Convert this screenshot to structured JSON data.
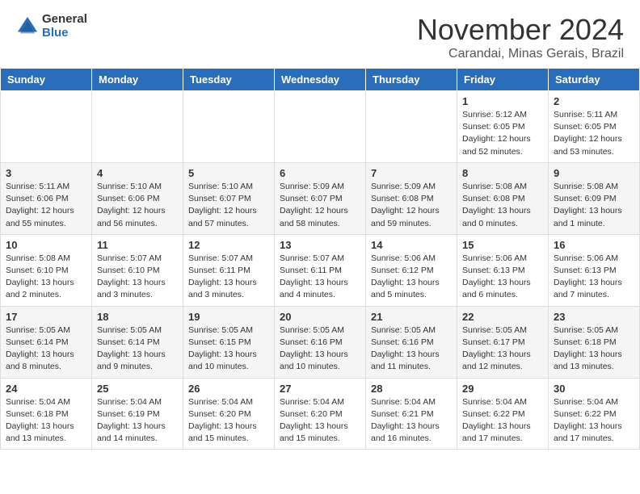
{
  "logo": {
    "general": "General",
    "blue": "Blue"
  },
  "title": "November 2024",
  "location": "Carandai, Minas Gerais, Brazil",
  "days_of_week": [
    "Sunday",
    "Monday",
    "Tuesday",
    "Wednesday",
    "Thursday",
    "Friday",
    "Saturday"
  ],
  "weeks": [
    [
      {
        "day": "",
        "info": ""
      },
      {
        "day": "",
        "info": ""
      },
      {
        "day": "",
        "info": ""
      },
      {
        "day": "",
        "info": ""
      },
      {
        "day": "",
        "info": ""
      },
      {
        "day": "1",
        "info": "Sunrise: 5:12 AM\nSunset: 6:05 PM\nDaylight: 12 hours\nand 52 minutes."
      },
      {
        "day": "2",
        "info": "Sunrise: 5:11 AM\nSunset: 6:05 PM\nDaylight: 12 hours\nand 53 minutes."
      }
    ],
    [
      {
        "day": "3",
        "info": "Sunrise: 5:11 AM\nSunset: 6:06 PM\nDaylight: 12 hours\nand 55 minutes."
      },
      {
        "day": "4",
        "info": "Sunrise: 5:10 AM\nSunset: 6:06 PM\nDaylight: 12 hours\nand 56 minutes."
      },
      {
        "day": "5",
        "info": "Sunrise: 5:10 AM\nSunset: 6:07 PM\nDaylight: 12 hours\nand 57 minutes."
      },
      {
        "day": "6",
        "info": "Sunrise: 5:09 AM\nSunset: 6:07 PM\nDaylight: 12 hours\nand 58 minutes."
      },
      {
        "day": "7",
        "info": "Sunrise: 5:09 AM\nSunset: 6:08 PM\nDaylight: 12 hours\nand 59 minutes."
      },
      {
        "day": "8",
        "info": "Sunrise: 5:08 AM\nSunset: 6:08 PM\nDaylight: 13 hours\nand 0 minutes."
      },
      {
        "day": "9",
        "info": "Sunrise: 5:08 AM\nSunset: 6:09 PM\nDaylight: 13 hours\nand 1 minute."
      }
    ],
    [
      {
        "day": "10",
        "info": "Sunrise: 5:08 AM\nSunset: 6:10 PM\nDaylight: 13 hours\nand 2 minutes."
      },
      {
        "day": "11",
        "info": "Sunrise: 5:07 AM\nSunset: 6:10 PM\nDaylight: 13 hours\nand 3 minutes."
      },
      {
        "day": "12",
        "info": "Sunrise: 5:07 AM\nSunset: 6:11 PM\nDaylight: 13 hours\nand 3 minutes."
      },
      {
        "day": "13",
        "info": "Sunrise: 5:07 AM\nSunset: 6:11 PM\nDaylight: 13 hours\nand 4 minutes."
      },
      {
        "day": "14",
        "info": "Sunrise: 5:06 AM\nSunset: 6:12 PM\nDaylight: 13 hours\nand 5 minutes."
      },
      {
        "day": "15",
        "info": "Sunrise: 5:06 AM\nSunset: 6:13 PM\nDaylight: 13 hours\nand 6 minutes."
      },
      {
        "day": "16",
        "info": "Sunrise: 5:06 AM\nSunset: 6:13 PM\nDaylight: 13 hours\nand 7 minutes."
      }
    ],
    [
      {
        "day": "17",
        "info": "Sunrise: 5:05 AM\nSunset: 6:14 PM\nDaylight: 13 hours\nand 8 minutes."
      },
      {
        "day": "18",
        "info": "Sunrise: 5:05 AM\nSunset: 6:14 PM\nDaylight: 13 hours\nand 9 minutes."
      },
      {
        "day": "19",
        "info": "Sunrise: 5:05 AM\nSunset: 6:15 PM\nDaylight: 13 hours\nand 10 minutes."
      },
      {
        "day": "20",
        "info": "Sunrise: 5:05 AM\nSunset: 6:16 PM\nDaylight: 13 hours\nand 10 minutes."
      },
      {
        "day": "21",
        "info": "Sunrise: 5:05 AM\nSunset: 6:16 PM\nDaylight: 13 hours\nand 11 minutes."
      },
      {
        "day": "22",
        "info": "Sunrise: 5:05 AM\nSunset: 6:17 PM\nDaylight: 13 hours\nand 12 minutes."
      },
      {
        "day": "23",
        "info": "Sunrise: 5:05 AM\nSunset: 6:18 PM\nDaylight: 13 hours\nand 13 minutes."
      }
    ],
    [
      {
        "day": "24",
        "info": "Sunrise: 5:04 AM\nSunset: 6:18 PM\nDaylight: 13 hours\nand 13 minutes."
      },
      {
        "day": "25",
        "info": "Sunrise: 5:04 AM\nSunset: 6:19 PM\nDaylight: 13 hours\nand 14 minutes."
      },
      {
        "day": "26",
        "info": "Sunrise: 5:04 AM\nSunset: 6:20 PM\nDaylight: 13 hours\nand 15 minutes."
      },
      {
        "day": "27",
        "info": "Sunrise: 5:04 AM\nSunset: 6:20 PM\nDaylight: 13 hours\nand 15 minutes."
      },
      {
        "day": "28",
        "info": "Sunrise: 5:04 AM\nSunset: 6:21 PM\nDaylight: 13 hours\nand 16 minutes."
      },
      {
        "day": "29",
        "info": "Sunrise: 5:04 AM\nSunset: 6:22 PM\nDaylight: 13 hours\nand 17 minutes."
      },
      {
        "day": "30",
        "info": "Sunrise: 5:04 AM\nSunset: 6:22 PM\nDaylight: 13 hours\nand 17 minutes."
      }
    ]
  ]
}
